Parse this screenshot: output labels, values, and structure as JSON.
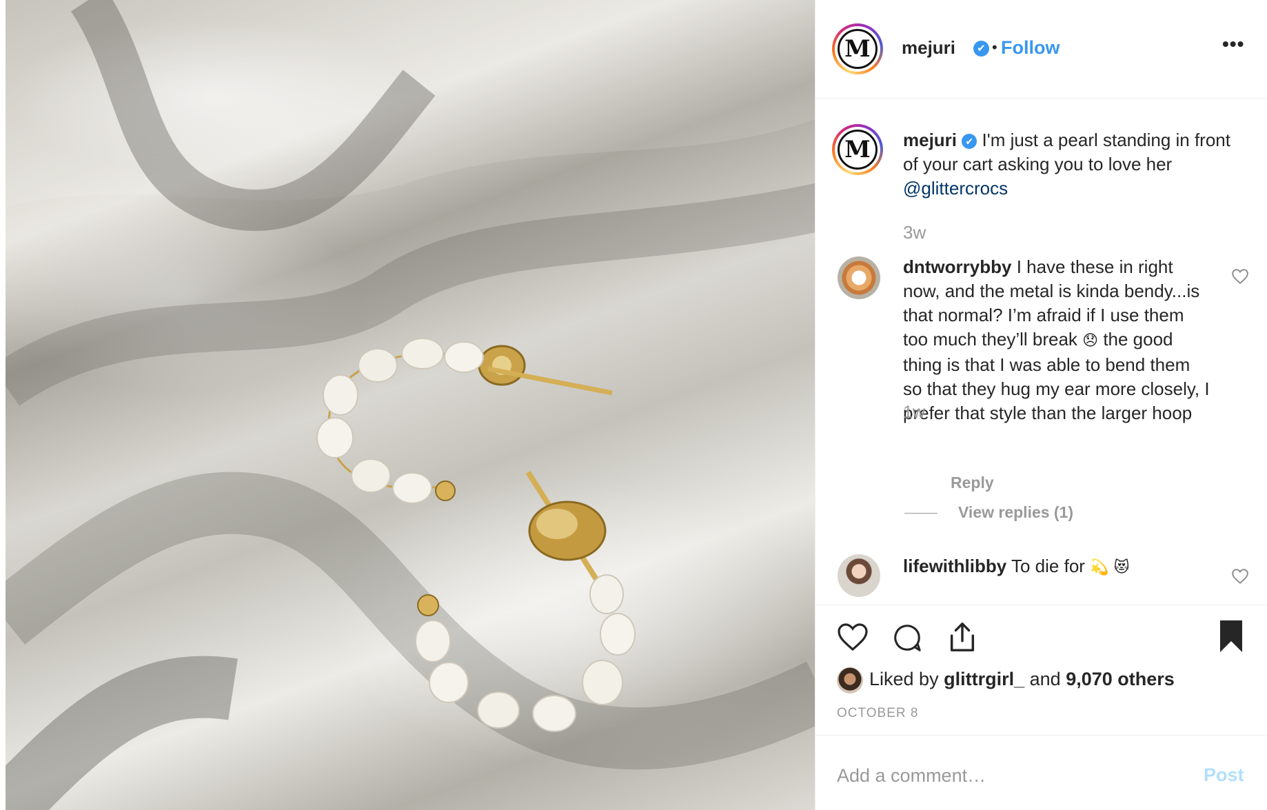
{
  "post": {
    "username": "mejuri",
    "verified_badge": "✔",
    "dot": "•",
    "follow_label": "Follow",
    "more_label": "•••",
    "avatar_letter": "M"
  },
  "caption": {
    "username": "mejuri",
    "text": "I'm just a pearl standing in front of your cart asking you to love her",
    "mention": "@glittercrocs",
    "time": "3w"
  },
  "comments": [
    {
      "username": "dntworrybby",
      "text_part1": "I have these in right now, and the metal is kinda bendy...is that normal? I’m afraid if I use them too much they’ll break",
      "emoji": "😞",
      "text_part2": "the good thing is that I was able to bend them so that they hug my ear more closely, I prefer that style than the larger hoop",
      "time": "1w",
      "reply_label": "Reply",
      "view_replies_label": "View replies (1)"
    },
    {
      "username": "lifewithlibby",
      "text": "To die for",
      "emoji": "💫 😻"
    }
  ],
  "actions": {
    "like_icon": "heart-icon",
    "comment_icon": "comment-icon",
    "share_icon": "share-icon",
    "save_icon": "bookmark-icon",
    "liked_prefix": "Liked by",
    "liked_user": "glittrgirl_",
    "liked_and": "and",
    "liked_others": "9,070 others",
    "date": "OCTOBER 8"
  },
  "add_comment": {
    "placeholder": "Add a comment…",
    "post_label": "Post"
  },
  "colors": {
    "link_blue": "#3897f0",
    "mention_blue": "#003569",
    "muted": "#999999",
    "post_disabled": "#b2dffc"
  }
}
